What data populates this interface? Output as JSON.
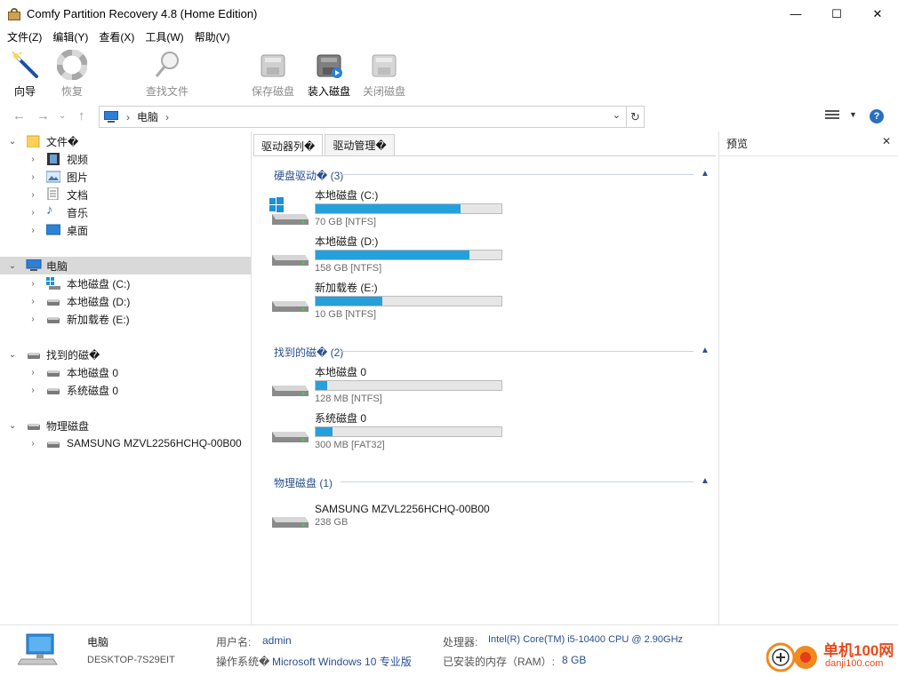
{
  "window": {
    "title": "Comfy Partition Recovery 4.8 (Home Edition)",
    "minimize": "—",
    "maximize": "☐",
    "close": "✕"
  },
  "menu": [
    "文件(Z)",
    "编辑(Y)",
    "查看(X)",
    "工具(W)",
    "帮助(V)"
  ],
  "toolbar": {
    "wizard": "向导",
    "recover": "恢复",
    "find_files": "查找文件",
    "save_disk": "保存磁盘",
    "load_disk": "装入磁盘",
    "close_disk": "关闭磁盘"
  },
  "address": {
    "location": "电脑",
    "separator": "›",
    "dropdown": "⌄",
    "refresh": "↻"
  },
  "tree": {
    "files": {
      "label": "文件�",
      "children": [
        "视频",
        "图片",
        "文档",
        "音乐",
        "桌面"
      ]
    },
    "computer": {
      "label": "电脑",
      "children": [
        "本地磁盘 (C:)",
        "本地磁盘 (D:)",
        "新加载卷 (E:)"
      ]
    },
    "found": {
      "label": "找到的磁�",
      "children": [
        "本地磁盘 0",
        "系统磁盘 0"
      ]
    },
    "physical": {
      "label": "物理磁盘",
      "children": [
        "SAMSUNG MZVL2256HCHQ-00B00"
      ]
    }
  },
  "tabs": [
    "驱动器列�",
    "驱动管理�"
  ],
  "groups": [
    {
      "header": "硬盘驱动� (3)",
      "drives": [
        {
          "name": "本地磁盘 (C:)",
          "info": "70 GB [NTFS]",
          "fill": 0.78,
          "icon": "windows-drive"
        },
        {
          "name": "本地磁盘 (D:)",
          "info": "158 GB [NTFS]",
          "fill": 0.83,
          "icon": "drive"
        },
        {
          "name": "新加载卷 (E:)",
          "info": "10 GB [NTFS]",
          "fill": 0.36,
          "icon": "drive"
        }
      ]
    },
    {
      "header": "找到的磁� (2)",
      "drives": [
        {
          "name": "本地磁盘 0",
          "info": "128 MB [NTFS]",
          "fill": 0.06,
          "icon": "drive"
        },
        {
          "name": "系统磁盘 0",
          "info": "300 MB [FAT32]",
          "fill": 0.09,
          "icon": "drive"
        }
      ]
    },
    {
      "header": "物理磁盘 (1)",
      "drives": [
        {
          "name": "SAMSUNG MZVL2256HCHQ-00B00",
          "info": "238 GB",
          "icon": "drive"
        }
      ]
    }
  ],
  "preview": {
    "title": "预览",
    "close": "✕"
  },
  "status": {
    "pc_label": "电脑",
    "pc_name": "DESKTOP-7S29EIT",
    "user_label": "用户名:",
    "user_value": "admin",
    "os_label": "操作系统�",
    "os_value": "Microsoft Windows 10 专业版",
    "cpu_label": "处理器:",
    "cpu_value": "Intel(R) Core(TM) i5-10400 CPU @ 2.90GHz",
    "ram_label": "已安装的内存（RAM）:",
    "ram_value": "8 GB"
  },
  "watermark": {
    "brand": "单机100网",
    "url": "danji100.com"
  }
}
